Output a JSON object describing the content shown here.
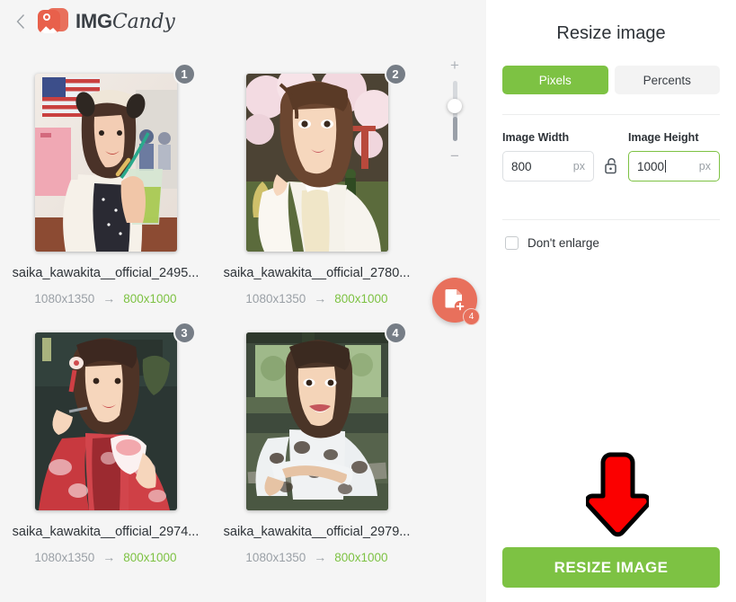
{
  "header": {
    "back_icon": "chevron-left-icon",
    "logo_icon": "image-photo-icon",
    "logo_text_bold": "IMG",
    "logo_text_script": "Candy"
  },
  "left_pane": {
    "zoom_slider": {
      "plus_label": "+",
      "minus_label": "−"
    },
    "add_files_fab": {
      "icon": "file-plus-icon",
      "count_badge": "4"
    },
    "images": [
      {
        "index_badge": "1",
        "filename": "saika_kawakita__official_2495...",
        "original_size": "1080x1350",
        "arrow": "→",
        "new_size": "800x1000"
      },
      {
        "index_badge": "2",
        "filename": "saika_kawakita__official_2780...",
        "original_size": "1080x1350",
        "arrow": "→",
        "new_size": "800x1000"
      },
      {
        "index_badge": "3",
        "filename": "saika_kawakita__official_2974...",
        "original_size": "1080x1350",
        "arrow": "→",
        "new_size": "800x1000"
      },
      {
        "index_badge": "4",
        "filename": "saika_kawakita__official_2979...",
        "original_size": "1080x1350",
        "arrow": "→",
        "new_size": "800x1000"
      }
    ]
  },
  "right_pane": {
    "title": "Resize image",
    "mode_tabs": {
      "pixels": "Pixels",
      "percents": "Percents",
      "active": "Pixels"
    },
    "width_field": {
      "label": "Image Width",
      "value": "800",
      "unit": "px",
      "focused": false
    },
    "aspect_lock": {
      "icon": "unlocked-padlock-icon",
      "state": "unlocked"
    },
    "height_field": {
      "label": "Image Height",
      "value": "1000",
      "unit": "px",
      "focused": true
    },
    "dont_enlarge": {
      "label": "Don't enlarge",
      "checked": false
    },
    "submit_button": "RESIZE IMAGE"
  },
  "annotation": {
    "arrow_icon": "red-down-arrow-annotation"
  },
  "colors": {
    "brand_green": "#7dc243",
    "brand_orange": "#e8705c",
    "badge_gray": "#767d86",
    "pane_bg": "#f5f5f5",
    "annotation_red": "#fb0000"
  }
}
